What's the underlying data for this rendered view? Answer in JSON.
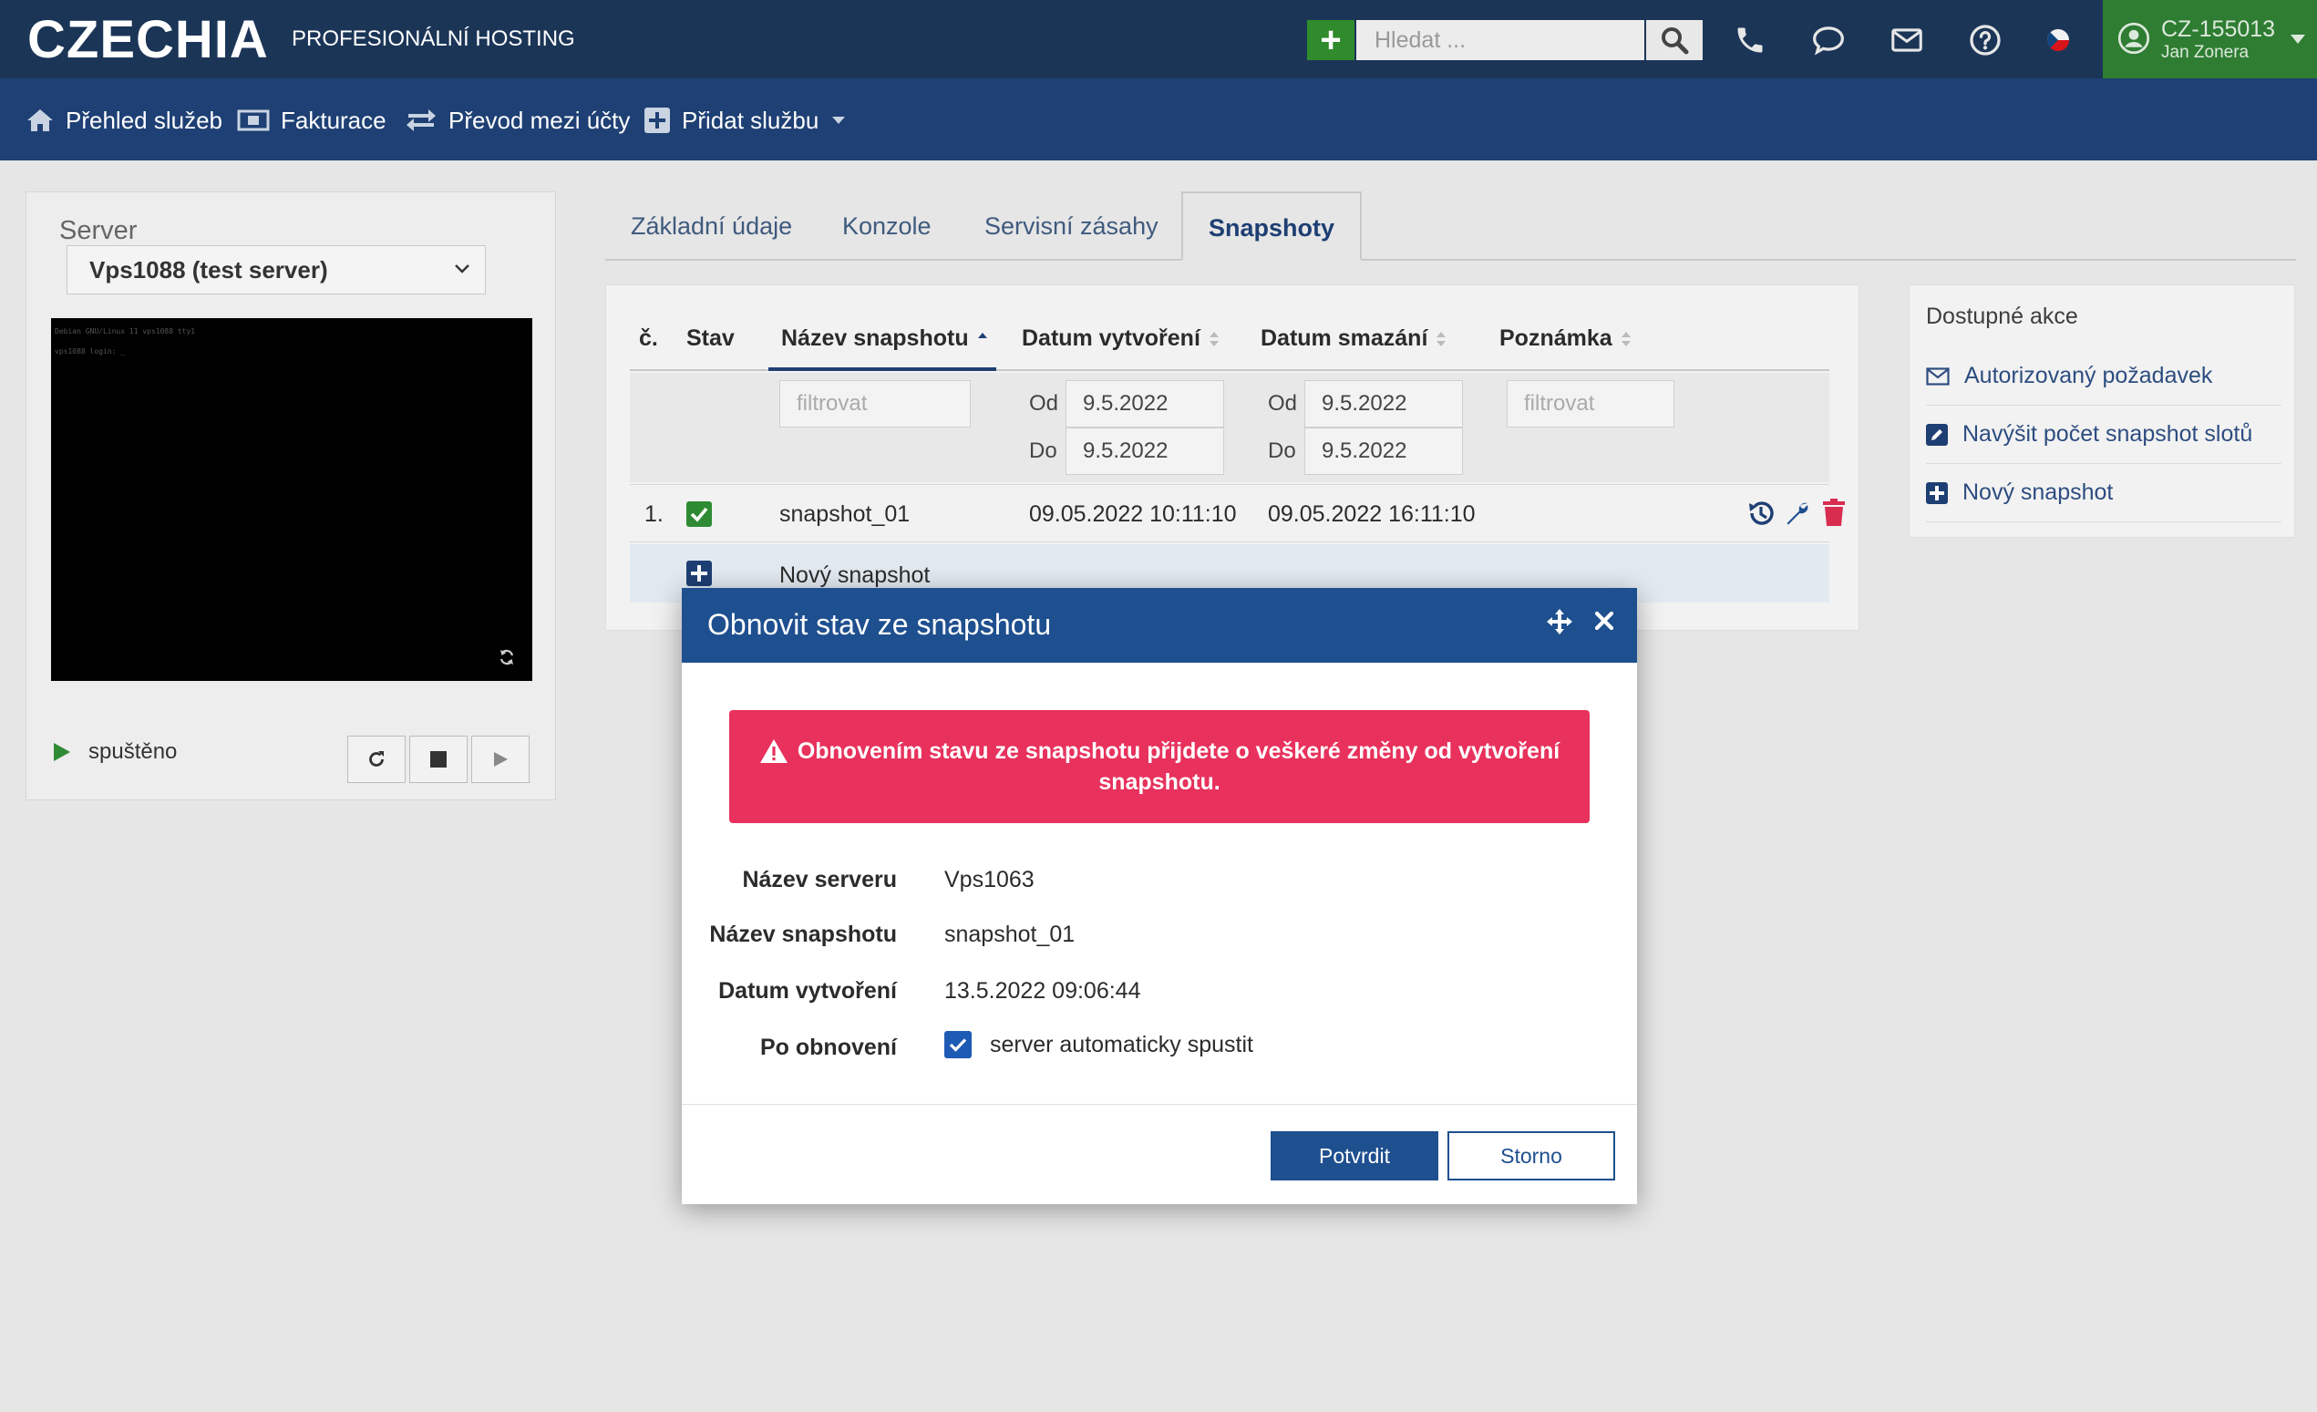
{
  "topbar": {
    "logo": "CZECHIA",
    "tagline": "PROFESIONÁLNÍ HOSTING",
    "search_placeholder": "Hledat ...",
    "user_id": "CZ-155013",
    "user_name": "Jan Zonera"
  },
  "nav": {
    "items": [
      {
        "label": "Přehled služeb",
        "icon": "home-icon"
      },
      {
        "label": "Fakturace",
        "icon": "money-icon"
      },
      {
        "label": "Převod mezi účty",
        "icon": "transfer-icon"
      },
      {
        "label": "Přidat službu",
        "icon": "plus-square-icon"
      }
    ]
  },
  "server": {
    "label": "Server",
    "selected": "Vps1088 (test server)",
    "console_lines": [
      "Debian GNU/Linux 11 vps1088 tty1",
      "vps1088 login: _"
    ],
    "state": "spuštěno"
  },
  "tabs": [
    {
      "label": "Základní údaje",
      "active": false
    },
    {
      "label": "Konzole",
      "active": false
    },
    {
      "label": "Servisní zásahy",
      "active": false
    },
    {
      "label": "Snapshoty",
      "active": true
    }
  ],
  "table": {
    "headers": {
      "num": "č.",
      "state": "Stav",
      "name": "Název snapshotu",
      "created": "Datum vytvoření",
      "deleted": "Datum smazání",
      "note": "Poznámka"
    },
    "filters": {
      "name_placeholder": "filtrovat",
      "note_placeholder": "filtrovat",
      "from_label": "Od",
      "to_label": "Do",
      "created_from": "9.5.2022",
      "created_to": "9.5.2022",
      "deleted_from": "9.5.2022",
      "deleted_to": "9.5.2022"
    },
    "rows": [
      {
        "num": "1.",
        "name": "snapshot_01",
        "created": "09.05.2022 10:11:10",
        "deleted": "09.05.2022 16:11:10"
      }
    ],
    "new_row_label": "Nový snapshot"
  },
  "actions": {
    "title": "Dostupné akce",
    "items": [
      {
        "label": "Autorizovaný požadavek",
        "icon": "envelope-icon"
      },
      {
        "label": "Navýšit počet snapshot slotů",
        "icon": "edit-icon"
      },
      {
        "label": "Nový snapshot",
        "icon": "plus-square-icon"
      }
    ]
  },
  "modal": {
    "title": "Obnovit stav ze snapshotu",
    "alert_line1": "Obnovením stavu ze snapshotu přijdete o veškeré změny od vytvoření",
    "alert_line2": "snapshotu.",
    "fields": [
      {
        "label": "Název serveru",
        "value": "Vps1063"
      },
      {
        "label": "Název snapshotu",
        "value": "snapshot_01"
      },
      {
        "label": "Datum vytvoření",
        "value": "13.5.2022 09:06:44"
      },
      {
        "label": "Po obnovení",
        "value": "server automaticky spustit"
      }
    ],
    "confirm_label": "Potvrdit",
    "cancel_label": "Storno"
  },
  "colors": {
    "topbar": "#1b3557",
    "navbar": "#1e4074",
    "user_box": "#2e7d32",
    "accent": "#1e4f8f",
    "alert": "#e8315c",
    "delete": "#d92d4f"
  }
}
